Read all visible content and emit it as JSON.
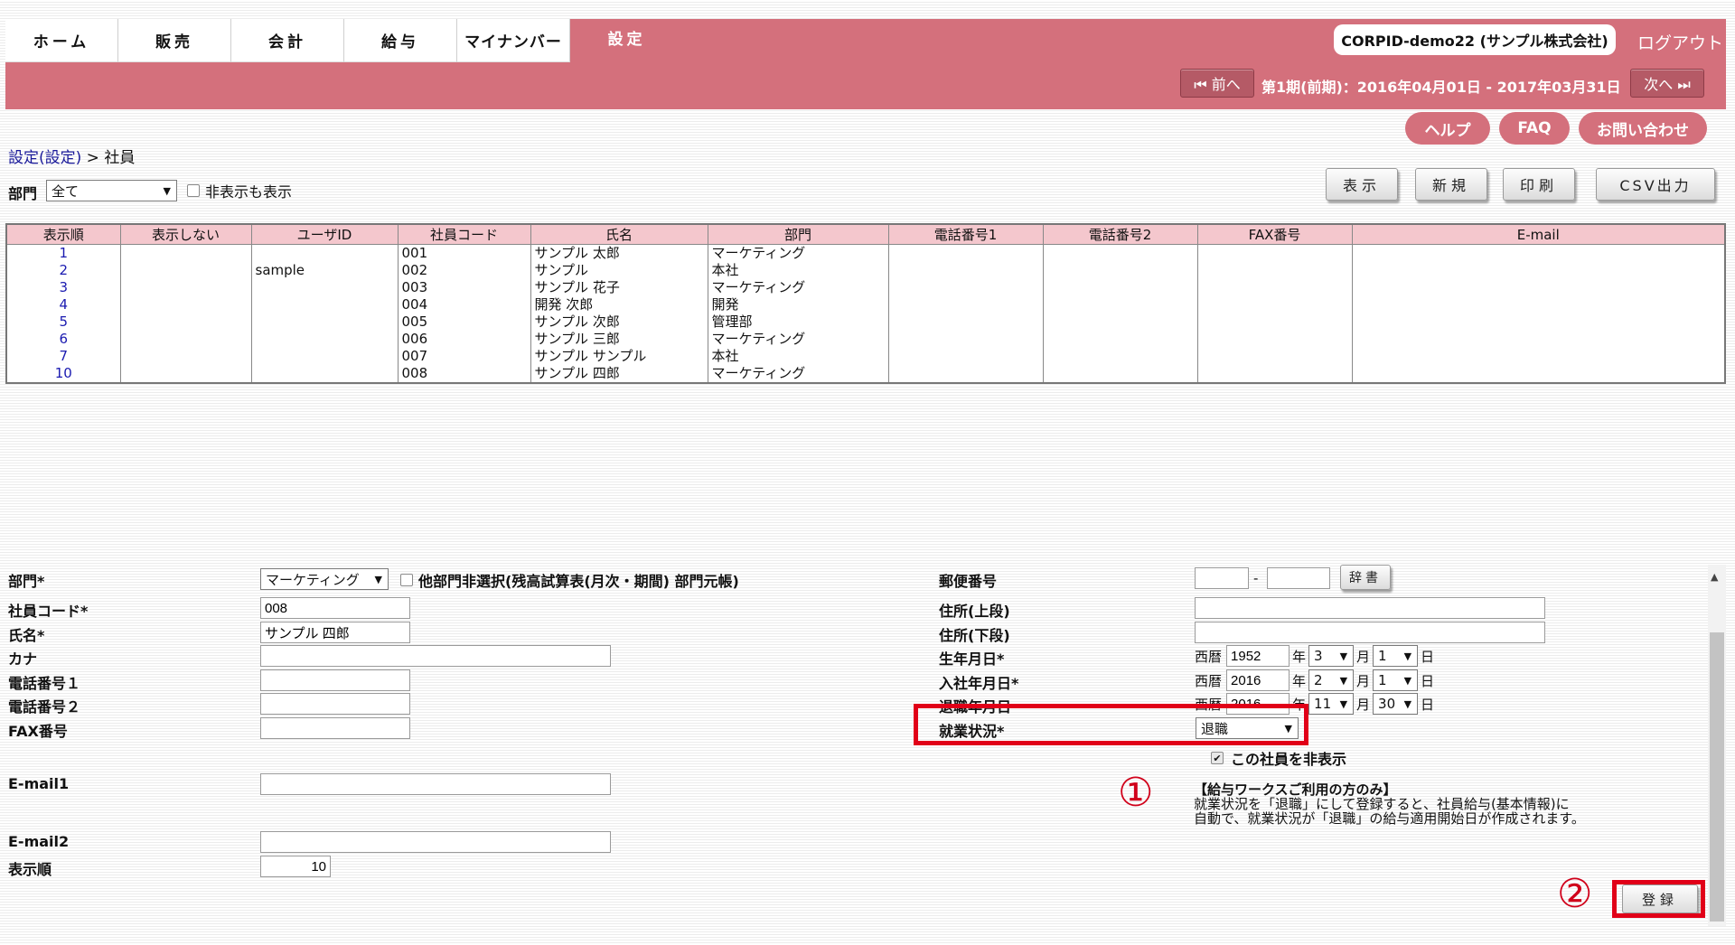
{
  "header": {
    "tabs": [
      "ホーム",
      "販売",
      "会計",
      "給与",
      "マイナンバー",
      "設定"
    ],
    "company": "CORPID-demo22 (サンプル株式会社)",
    "logout": "ログアウト",
    "prev": "⏮ 前へ",
    "next": "次へ ⏭",
    "period": "第1期(前期)：2016年04月01日 - 2017年03月31日",
    "help": "ヘルプ",
    "faq": "FAQ",
    "contact": "お問い合わせ"
  },
  "breadcrumb": {
    "parent": "設定(設定)",
    "separator": ">",
    "current": "社員"
  },
  "filter": {
    "label": "部門",
    "value": "全て",
    "show_hidden": "非表示も表示"
  },
  "toolbar": {
    "show": "表示",
    "new": "新規",
    "print": "印刷",
    "csv": "CSV出力"
  },
  "table": {
    "headers": [
      "表示順",
      "表示しない",
      "ユーザID",
      "社員コード",
      "氏名",
      "部門",
      "電話番号1",
      "電話番号2",
      "FAX番号",
      "E-mail"
    ],
    "rows": [
      [
        "1",
        "",
        "",
        "001",
        "サンプル 太郎",
        "マーケティング",
        "",
        "",
        "",
        ""
      ],
      [
        "2",
        "",
        "sample",
        "002",
        "サンプル",
        "本社",
        "",
        "",
        "",
        ""
      ],
      [
        "3",
        "",
        "",
        "003",
        "サンプル 花子",
        "マーケティング",
        "",
        "",
        "",
        ""
      ],
      [
        "4",
        "",
        "",
        "004",
        "開発 次郎",
        "開発",
        "",
        "",
        "",
        ""
      ],
      [
        "5",
        "",
        "",
        "005",
        "サンプル 次郎",
        "管理部",
        "",
        "",
        "",
        ""
      ],
      [
        "6",
        "",
        "",
        "006",
        "サンプル 三郎",
        "マーケティング",
        "",
        "",
        "",
        ""
      ],
      [
        "7",
        "",
        "",
        "007",
        "サンプル サンプル",
        "本社",
        "",
        "",
        "",
        ""
      ],
      [
        "10",
        "",
        "",
        "008",
        "サンプル 四郎",
        "マーケティング",
        "",
        "",
        "",
        ""
      ]
    ]
  },
  "form": {
    "dept_label": "部門*",
    "dept_value": "マーケティング",
    "dept_note": "他部門非選択(残高試算表(月次・期間) 部門元帳)",
    "code_label": "社員コード*",
    "code_value": "008",
    "name_label": "氏名*",
    "name_value": "サンプル 四郎",
    "kana_label": "カナ",
    "tel1_label": "電話番号１",
    "tel2_label": "電話番号２",
    "fax_label": "FAX番号",
    "email1_label": "E-mail1",
    "email2_label": "E-mail2",
    "order_label": "表示順",
    "order_value": "10",
    "zip_label": "郵便番号",
    "zip_dash": "-",
    "dict_button": "辞書",
    "addr1_label": "住所(上段)",
    "addr2_label": "住所(下段)",
    "birth_label": "生年月日*",
    "join_label": "入社年月日*",
    "leave_label": "退職年月日",
    "era": "西暦",
    "year_unit": "年",
    "month_unit": "月",
    "day_unit": "日",
    "birth": {
      "year": "1952",
      "month": "3",
      "day": "1"
    },
    "join": {
      "year": "2016",
      "month": "2",
      "day": "1"
    },
    "leave": {
      "year": "2016",
      "month": "11",
      "day": "30"
    },
    "status_label": "就業状況*",
    "status_value": "退職",
    "hide_label": "この社員を非表示",
    "note_title": "【給与ワークスご利用の方のみ】",
    "note_line1": "就業状況を「退職」にして登録すると、社員給与(基本情報)に",
    "note_line2": "自動で、就業状況が「退職」の給与適用開始日が作成されます。",
    "marker1": "①",
    "marker2": "②",
    "register": "登録"
  },
  "colors": {
    "brand": "#d4707c",
    "highlight": "#e10018",
    "table_header": "#f4c7cd"
  }
}
